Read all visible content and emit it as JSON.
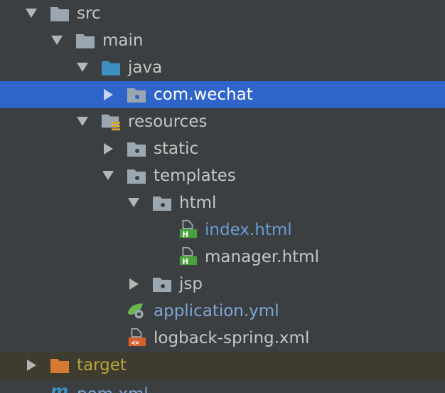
{
  "tree": {
    "src": "src",
    "main": "main",
    "java": "java",
    "com_wechat": "com.wechat",
    "resources": "resources",
    "static": "static",
    "templates": "templates",
    "html": "html",
    "index_html": "index.html",
    "manager_html": "manager.html",
    "jsp": "jsp",
    "application_yml": "application.yml",
    "logback_xml": "logback-spring.xml",
    "target": "target",
    "pom_xml": "pom.xml"
  },
  "icons": {
    "folder": "folder-icon",
    "source_root": "source-folder-icon",
    "package": "package-icon",
    "resources_root": "resources-folder-icon",
    "html_file": "html-file-icon",
    "spring_yml": "spring-config-icon",
    "xml_file": "xml-file-icon",
    "maven": "maven-icon"
  },
  "colors": {
    "background": "#3c3f41",
    "selection": "#2f65ca",
    "excluded_row": "#3e3c2f",
    "folder": "#9aa7b0",
    "source_folder": "#3d8fbf",
    "target_folder": "#d67933",
    "html_badge": "#48a13b",
    "xml_badge": "#d5612f",
    "spring_leaf": "#6cb650"
  }
}
